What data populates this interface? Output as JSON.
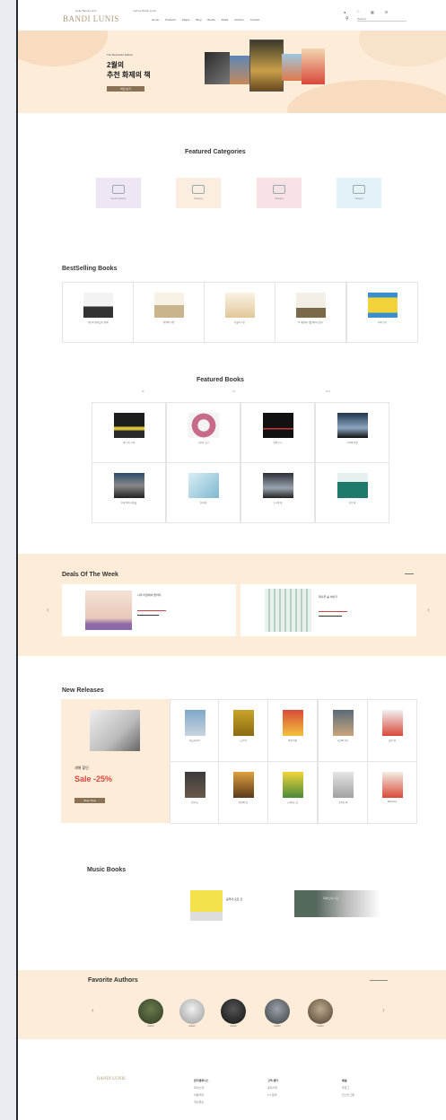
{
  "header": {
    "topline": [
      "Hello Bandi Lunis",
      "Call us Bandi Lunis"
    ],
    "logo": "BANDI LUNIS",
    "nav": [
      "Home",
      "Products",
      "Pages",
      "Blog",
      "Books",
      "Deals",
      "Authors",
      "Contact"
    ],
    "icons": [
      "user-icon",
      "heart-icon",
      "cart-icon",
      "menu-icon"
    ],
    "search_placeholder": "Search..."
  },
  "hero": {
    "subtitle": "The Bestseller Edition",
    "title": "2월의\n추천 화제의 책",
    "button": "바로 보기"
  },
  "featured_categories": {
    "title": "Featured Categories",
    "items": [
      {
        "label": "Small Category"
      },
      {
        "label": "Category"
      },
      {
        "label": "Category"
      },
      {
        "label": "Category"
      }
    ],
    "colors": [
      "#efe6f4",
      "#fbeee0",
      "#f8e2e6",
      "#e2f2f6"
    ]
  },
  "bestselling": {
    "title": "BestSelling Books",
    "books": [
      {
        "title": "대도와 함께 살기 위해"
      },
      {
        "title": "취향의 기원"
      },
      {
        "title": "사물과 시간"
      },
      {
        "title": "이 세상에 너를 데리러 왔다"
      },
      {
        "title": "나의 오리"
      }
    ]
  },
  "featured_books": {
    "title": "Featured Books",
    "tabs": [
      "All",
      "Art",
      "Kids"
    ],
    "books": [
      {
        "title": "바다 위 고래"
      },
      {
        "title": "시간과 소년"
      },
      {
        "title": "밤의 도시"
      },
      {
        "title": "건축의 풍경"
      },
      {
        "title": "무대 위의 사람들"
      },
      {
        "title": "흰 바람"
      },
      {
        "title": "도시의 창"
      },
      {
        "title": "푸른 책"
      }
    ]
  },
  "deals": {
    "title": "Deals Of The Week",
    "items": [
      {
        "title": "나의 아침에서 밤까지"
      },
      {
        "title": "대나무 숲 이야기"
      }
    ]
  },
  "new_releases": {
    "title": "New Releases",
    "promo_label": "새해 할인",
    "promo_sale": "Sale -25%",
    "promo_button": "Shop Now",
    "books": [
      {
        "title": "하늘과 바다"
      },
      {
        "title": "노란 방"
      },
      {
        "title": "어떤 여름"
      },
      {
        "title": "사진의 역사"
      },
      {
        "title": "붉은 펜"
      },
      {
        "title": "밤과 낮"
      },
      {
        "title": "정원의 빛"
      },
      {
        "title": "노래하는 숲"
      },
      {
        "title": "조용한 책"
      },
      {
        "title": "Welcome"
      }
    ]
  },
  "music_books": {
    "title": "Music Books",
    "items": [
      {
        "title": "음악의 모든 것"
      },
      {
        "title": "피아노의 시간"
      }
    ]
  },
  "favorite_authors": {
    "title": "Favorite Authors",
    "authors": [
      "Author",
      "Author",
      "Author",
      "Author",
      "Author"
    ]
  },
  "footer": {
    "logo": "BANDI LUNIS",
    "columns": [
      {
        "title": "반디앤루니스",
        "links": [
          "회사소개",
          "이용약관",
          "개인정보"
        ]
      },
      {
        "title": "고객 센터",
        "links": [
          "공지사항",
          "1:1 문의"
        ]
      },
      {
        "title": "채널",
        "links": [
          "블로그",
          "인스타그램"
        ]
      }
    ]
  },
  "colors": {
    "accent": "#fcecd8",
    "brand": "#b0977a",
    "sale": "#d9453d"
  }
}
